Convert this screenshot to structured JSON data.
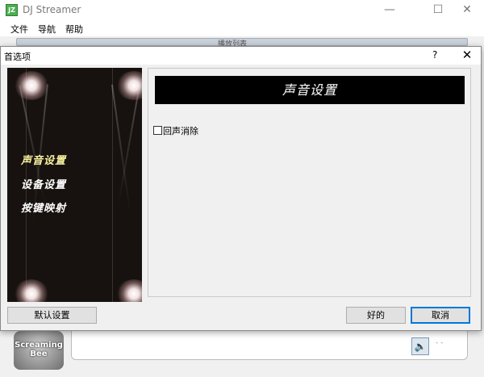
{
  "main_window": {
    "icon_text": "JZ",
    "title": "DJ Streamer",
    "controls": {
      "minimize": "—",
      "maximize": "☐",
      "close": "✕"
    },
    "menu": [
      "文件",
      "导航",
      "帮助"
    ],
    "under_bar_text": "播放列表",
    "logo_text": "Screaming Bee",
    "speaker_glyph": "🔈",
    "mini_marks": "-  -"
  },
  "dialog": {
    "title": "首选项",
    "help": "?",
    "close": "✕",
    "sidebar": {
      "items": [
        "声音设置",
        "设备设置",
        "按键映射"
      ],
      "active_index": 0
    },
    "header": "声音设置",
    "echo_cancel": {
      "label": "回声消除",
      "checked": false
    },
    "buttons": {
      "defaults": "默认设置",
      "ok": "好的",
      "cancel": "取消"
    }
  }
}
